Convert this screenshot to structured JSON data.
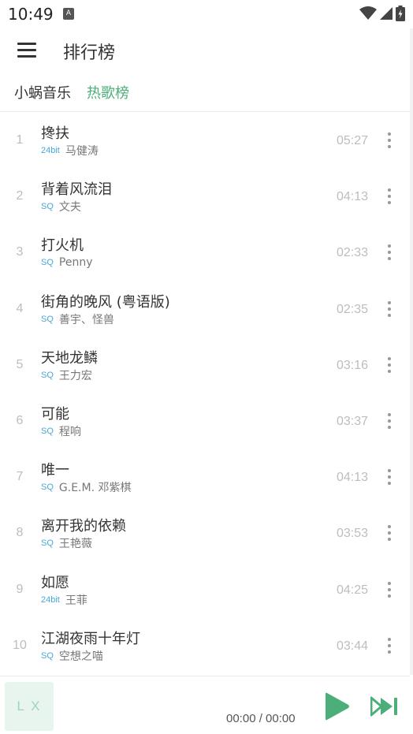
{
  "status_bar": {
    "time": "10:49",
    "notification_glyph": "A"
  },
  "app_bar": {
    "title": "排行榜",
    "menu_icon": "hamburger-menu-icon"
  },
  "breadcrumb": {
    "source": "小蜗音乐",
    "board": "热歌榜"
  },
  "songs": [
    {
      "index": "1",
      "title": "搀扶",
      "quality": "24bit",
      "artist": "马健涛",
      "duration": "05:27"
    },
    {
      "index": "2",
      "title": "背着风流泪",
      "quality": "SQ",
      "artist": "文夫",
      "duration": "04:13"
    },
    {
      "index": "3",
      "title": "打火机",
      "quality": "SQ",
      "artist": "Penny",
      "duration": "02:33"
    },
    {
      "index": "4",
      "title": "街角的晚风 (粤语版)",
      "quality": "SQ",
      "artist": "善宇、怪兽",
      "duration": "02:35"
    },
    {
      "index": "5",
      "title": "天地龙鳞",
      "quality": "SQ",
      "artist": "王力宏",
      "duration": "03:16"
    },
    {
      "index": "6",
      "title": "可能",
      "quality": "SQ",
      "artist": "程响",
      "duration": "03:37"
    },
    {
      "index": "7",
      "title": "唯一",
      "quality": "SQ",
      "artist": "G.E.M. 邓紫棋",
      "duration": "04:13"
    },
    {
      "index": "8",
      "title": "离开我的依赖",
      "quality": "SQ",
      "artist": "王艳薇",
      "duration": "03:53"
    },
    {
      "index": "9",
      "title": "如愿",
      "quality": "24bit",
      "artist": "王菲",
      "duration": "04:25"
    },
    {
      "index": "10",
      "title": "江湖夜雨十年灯",
      "quality": "SQ",
      "artist": "空想之喵",
      "duration": "03:44"
    }
  ],
  "player": {
    "cover_text": "L X",
    "time": "00:00 / 00:00",
    "play_icon": "play-icon",
    "next_icon": "next-track-icon"
  },
  "colors": {
    "accent": "#4caf7a",
    "quality_badge": "#4aa7d8",
    "muted": "#bdbdbd"
  }
}
